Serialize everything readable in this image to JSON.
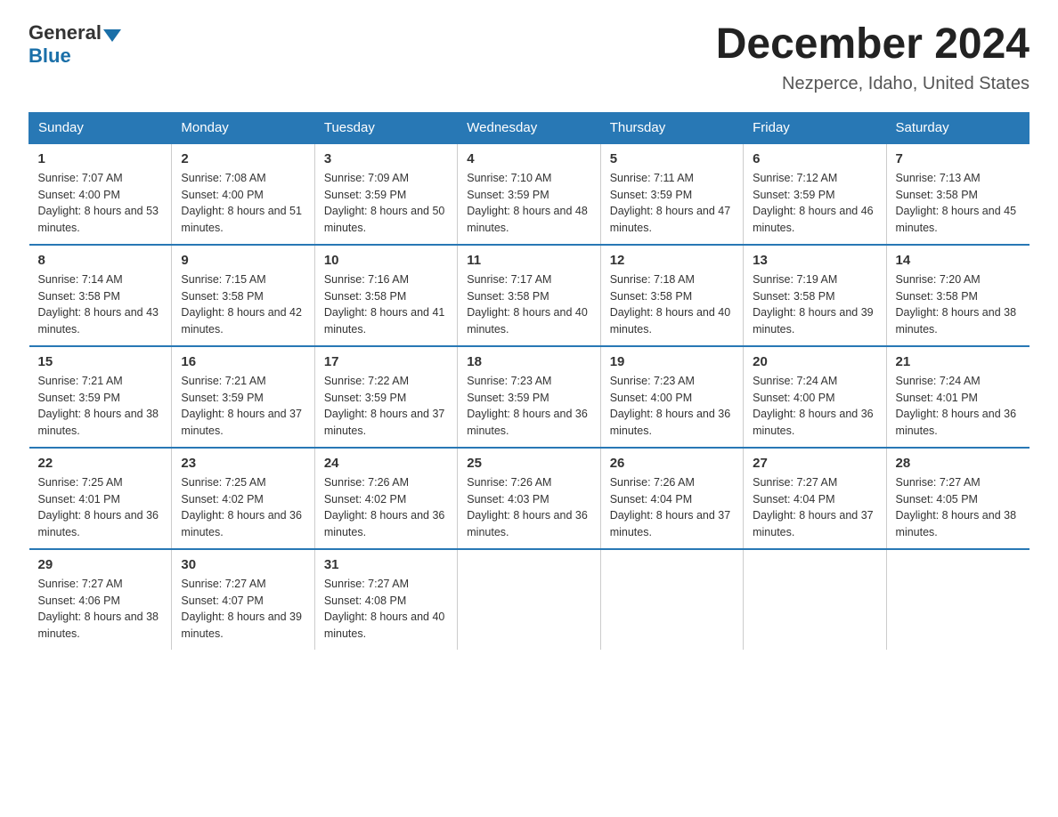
{
  "header": {
    "logo_general": "General",
    "logo_blue": "Blue",
    "month_title": "December 2024",
    "location": "Nezperce, Idaho, United States"
  },
  "days_of_week": [
    "Sunday",
    "Monday",
    "Tuesday",
    "Wednesday",
    "Thursday",
    "Friday",
    "Saturday"
  ],
  "weeks": [
    [
      {
        "num": "1",
        "sunrise": "7:07 AM",
        "sunset": "4:00 PM",
        "daylight": "8 hours and 53 minutes."
      },
      {
        "num": "2",
        "sunrise": "7:08 AM",
        "sunset": "4:00 PM",
        "daylight": "8 hours and 51 minutes."
      },
      {
        "num": "3",
        "sunrise": "7:09 AM",
        "sunset": "3:59 PM",
        "daylight": "8 hours and 50 minutes."
      },
      {
        "num": "4",
        "sunrise": "7:10 AM",
        "sunset": "3:59 PM",
        "daylight": "8 hours and 48 minutes."
      },
      {
        "num": "5",
        "sunrise": "7:11 AM",
        "sunset": "3:59 PM",
        "daylight": "8 hours and 47 minutes."
      },
      {
        "num": "6",
        "sunrise": "7:12 AM",
        "sunset": "3:59 PM",
        "daylight": "8 hours and 46 minutes."
      },
      {
        "num": "7",
        "sunrise": "7:13 AM",
        "sunset": "3:58 PM",
        "daylight": "8 hours and 45 minutes."
      }
    ],
    [
      {
        "num": "8",
        "sunrise": "7:14 AM",
        "sunset": "3:58 PM",
        "daylight": "8 hours and 43 minutes."
      },
      {
        "num": "9",
        "sunrise": "7:15 AM",
        "sunset": "3:58 PM",
        "daylight": "8 hours and 42 minutes."
      },
      {
        "num": "10",
        "sunrise": "7:16 AM",
        "sunset": "3:58 PM",
        "daylight": "8 hours and 41 minutes."
      },
      {
        "num": "11",
        "sunrise": "7:17 AM",
        "sunset": "3:58 PM",
        "daylight": "8 hours and 40 minutes."
      },
      {
        "num": "12",
        "sunrise": "7:18 AM",
        "sunset": "3:58 PM",
        "daylight": "8 hours and 40 minutes."
      },
      {
        "num": "13",
        "sunrise": "7:19 AM",
        "sunset": "3:58 PM",
        "daylight": "8 hours and 39 minutes."
      },
      {
        "num": "14",
        "sunrise": "7:20 AM",
        "sunset": "3:58 PM",
        "daylight": "8 hours and 38 minutes."
      }
    ],
    [
      {
        "num": "15",
        "sunrise": "7:21 AM",
        "sunset": "3:59 PM",
        "daylight": "8 hours and 38 minutes."
      },
      {
        "num": "16",
        "sunrise": "7:21 AM",
        "sunset": "3:59 PM",
        "daylight": "8 hours and 37 minutes."
      },
      {
        "num": "17",
        "sunrise": "7:22 AM",
        "sunset": "3:59 PM",
        "daylight": "8 hours and 37 minutes."
      },
      {
        "num": "18",
        "sunrise": "7:23 AM",
        "sunset": "3:59 PM",
        "daylight": "8 hours and 36 minutes."
      },
      {
        "num": "19",
        "sunrise": "7:23 AM",
        "sunset": "4:00 PM",
        "daylight": "8 hours and 36 minutes."
      },
      {
        "num": "20",
        "sunrise": "7:24 AM",
        "sunset": "4:00 PM",
        "daylight": "8 hours and 36 minutes."
      },
      {
        "num": "21",
        "sunrise": "7:24 AM",
        "sunset": "4:01 PM",
        "daylight": "8 hours and 36 minutes."
      }
    ],
    [
      {
        "num": "22",
        "sunrise": "7:25 AM",
        "sunset": "4:01 PM",
        "daylight": "8 hours and 36 minutes."
      },
      {
        "num": "23",
        "sunrise": "7:25 AM",
        "sunset": "4:02 PM",
        "daylight": "8 hours and 36 minutes."
      },
      {
        "num": "24",
        "sunrise": "7:26 AM",
        "sunset": "4:02 PM",
        "daylight": "8 hours and 36 minutes."
      },
      {
        "num": "25",
        "sunrise": "7:26 AM",
        "sunset": "4:03 PM",
        "daylight": "8 hours and 36 minutes."
      },
      {
        "num": "26",
        "sunrise": "7:26 AM",
        "sunset": "4:04 PM",
        "daylight": "8 hours and 37 minutes."
      },
      {
        "num": "27",
        "sunrise": "7:27 AM",
        "sunset": "4:04 PM",
        "daylight": "8 hours and 37 minutes."
      },
      {
        "num": "28",
        "sunrise": "7:27 AM",
        "sunset": "4:05 PM",
        "daylight": "8 hours and 38 minutes."
      }
    ],
    [
      {
        "num": "29",
        "sunrise": "7:27 AM",
        "sunset": "4:06 PM",
        "daylight": "8 hours and 38 minutes."
      },
      {
        "num": "30",
        "sunrise": "7:27 AM",
        "sunset": "4:07 PM",
        "daylight": "8 hours and 39 minutes."
      },
      {
        "num": "31",
        "sunrise": "7:27 AM",
        "sunset": "4:08 PM",
        "daylight": "8 hours and 40 minutes."
      },
      null,
      null,
      null,
      null
    ]
  ]
}
